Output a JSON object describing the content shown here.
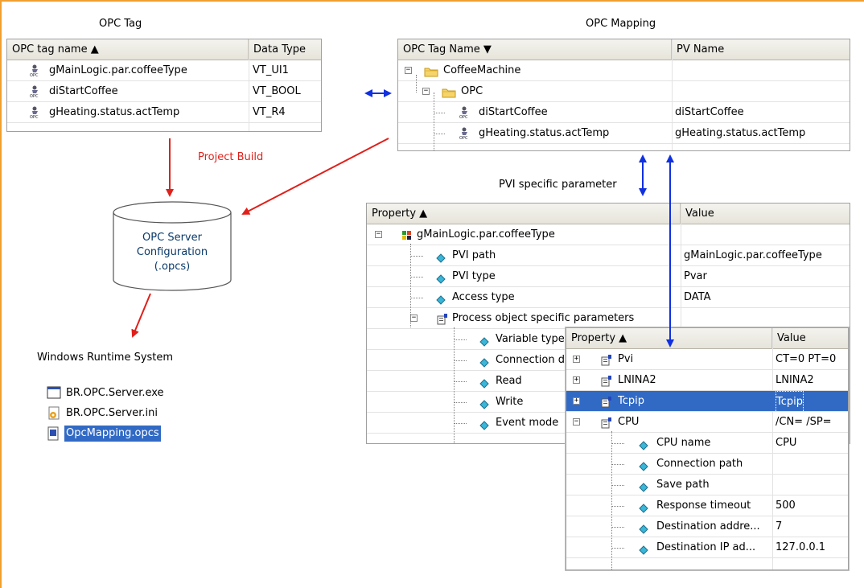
{
  "titles": {
    "opc_tag": "OPC Tag",
    "opc_mapping": "OPC Mapping",
    "pvi_specific": "PVI specific parameter",
    "project_build": "Project Build",
    "windows_runtime": "Windows Runtime System"
  },
  "colors": {
    "frame": "#f0a030",
    "red_arrow": "#e0201a",
    "blue_arrow": "#1030e0",
    "selection": "#316ac5"
  },
  "opc_tag_panel": {
    "columns": [
      "OPC tag name ▲",
      "Data Type"
    ],
    "rows": [
      {
        "icon": "opc-tag-icon",
        "name": "gMainLogic.par.coffeeType",
        "type": "VT_UI1"
      },
      {
        "icon": "opc-tag-icon",
        "name": "diStartCoffee",
        "type": "VT_BOOL"
      },
      {
        "icon": "opc-tag-icon",
        "name": "gHeating.status.actTemp",
        "type": "VT_R4"
      }
    ]
  },
  "opc_mapping_panel": {
    "columns": [
      "OPC Tag Name ▼",
      "PV Name"
    ],
    "rows": [
      {
        "icon": "folder-icon",
        "name": "CoffeeMachine",
        "pv": "",
        "expander": "−"
      },
      {
        "icon": "folder-icon",
        "name": "OPC",
        "pv": "",
        "expander": "−"
      },
      {
        "icon": "opc-tag-icon",
        "name": "diStartCoffee",
        "pv": "diStartCoffee"
      },
      {
        "icon": "opc-tag-icon",
        "name": "gHeating.status.actTemp",
        "pv": "gHeating.status.actTemp"
      }
    ]
  },
  "property_panel_1": {
    "columns": [
      "Property ▲",
      "Value"
    ],
    "rows": [
      {
        "icon": "variable-icon",
        "name": "gMainLogic.par.coffeeType",
        "value": "",
        "expander": "−"
      },
      {
        "icon": "property-diamond-icon",
        "name": "PVI path",
        "value": "gMainLogic.par.coffeeType"
      },
      {
        "icon": "property-diamond-icon",
        "name": "PVI type",
        "value": "Pvar"
      },
      {
        "icon": "property-diamond-icon",
        "name": "Access type",
        "value": "DATA"
      },
      {
        "icon": "property-group-icon",
        "name": "Process object specific parameters",
        "value": "",
        "expander": "−"
      },
      {
        "icon": "property-diamond-icon",
        "name": "Variable type",
        "value": ""
      },
      {
        "icon": "property-diamond-icon",
        "name": "Connection d",
        "value": ""
      },
      {
        "icon": "property-diamond-icon",
        "name": "Read",
        "value": ""
      },
      {
        "icon": "property-diamond-icon",
        "name": "Write",
        "value": ""
      },
      {
        "icon": "property-diamond-icon",
        "name": "Event mode",
        "value": ""
      }
    ]
  },
  "property_panel_2": {
    "columns": [
      "Property ▲",
      "Value"
    ],
    "rows": [
      {
        "icon": "property-group-icon",
        "name": "Pvi",
        "value": "CT=0 PT=0",
        "expander": "+"
      },
      {
        "icon": "property-group-icon",
        "name": "LNINA2",
        "value": "LNINA2",
        "expander": "+"
      },
      {
        "icon": "property-group-icon",
        "name": "Tcpip",
        "value": "Tcpip",
        "expander": "+",
        "selected": true
      },
      {
        "icon": "property-group-icon",
        "name": "CPU",
        "value": "/CN= /SP=",
        "expander": "−"
      },
      {
        "icon": "property-diamond-icon",
        "name": "CPU name",
        "value": "CPU"
      },
      {
        "icon": "property-diamond-icon",
        "name": "Connection path",
        "value": ""
      },
      {
        "icon": "property-diamond-icon",
        "name": "Save path",
        "value": ""
      },
      {
        "icon": "property-diamond-icon",
        "name": "Response timeout",
        "value": "500"
      },
      {
        "icon": "property-diamond-icon",
        "name": "Destination addre...",
        "value": "7"
      },
      {
        "icon": "property-diamond-icon",
        "name": "Destination IP ad...",
        "value": "127.0.0.1"
      }
    ]
  },
  "server_config": {
    "line1": "OPC Server",
    "line2": "Configuration",
    "line3": "(.opcs)"
  },
  "files": [
    {
      "icon": "exe-window-icon",
      "name": "BR.OPC.Server.exe"
    },
    {
      "icon": "ini-file-icon",
      "name": "BR.OPC.Server.ini"
    },
    {
      "icon": "opcs-file-icon",
      "name": "OpcMapping.opcs",
      "selected": true
    }
  ]
}
